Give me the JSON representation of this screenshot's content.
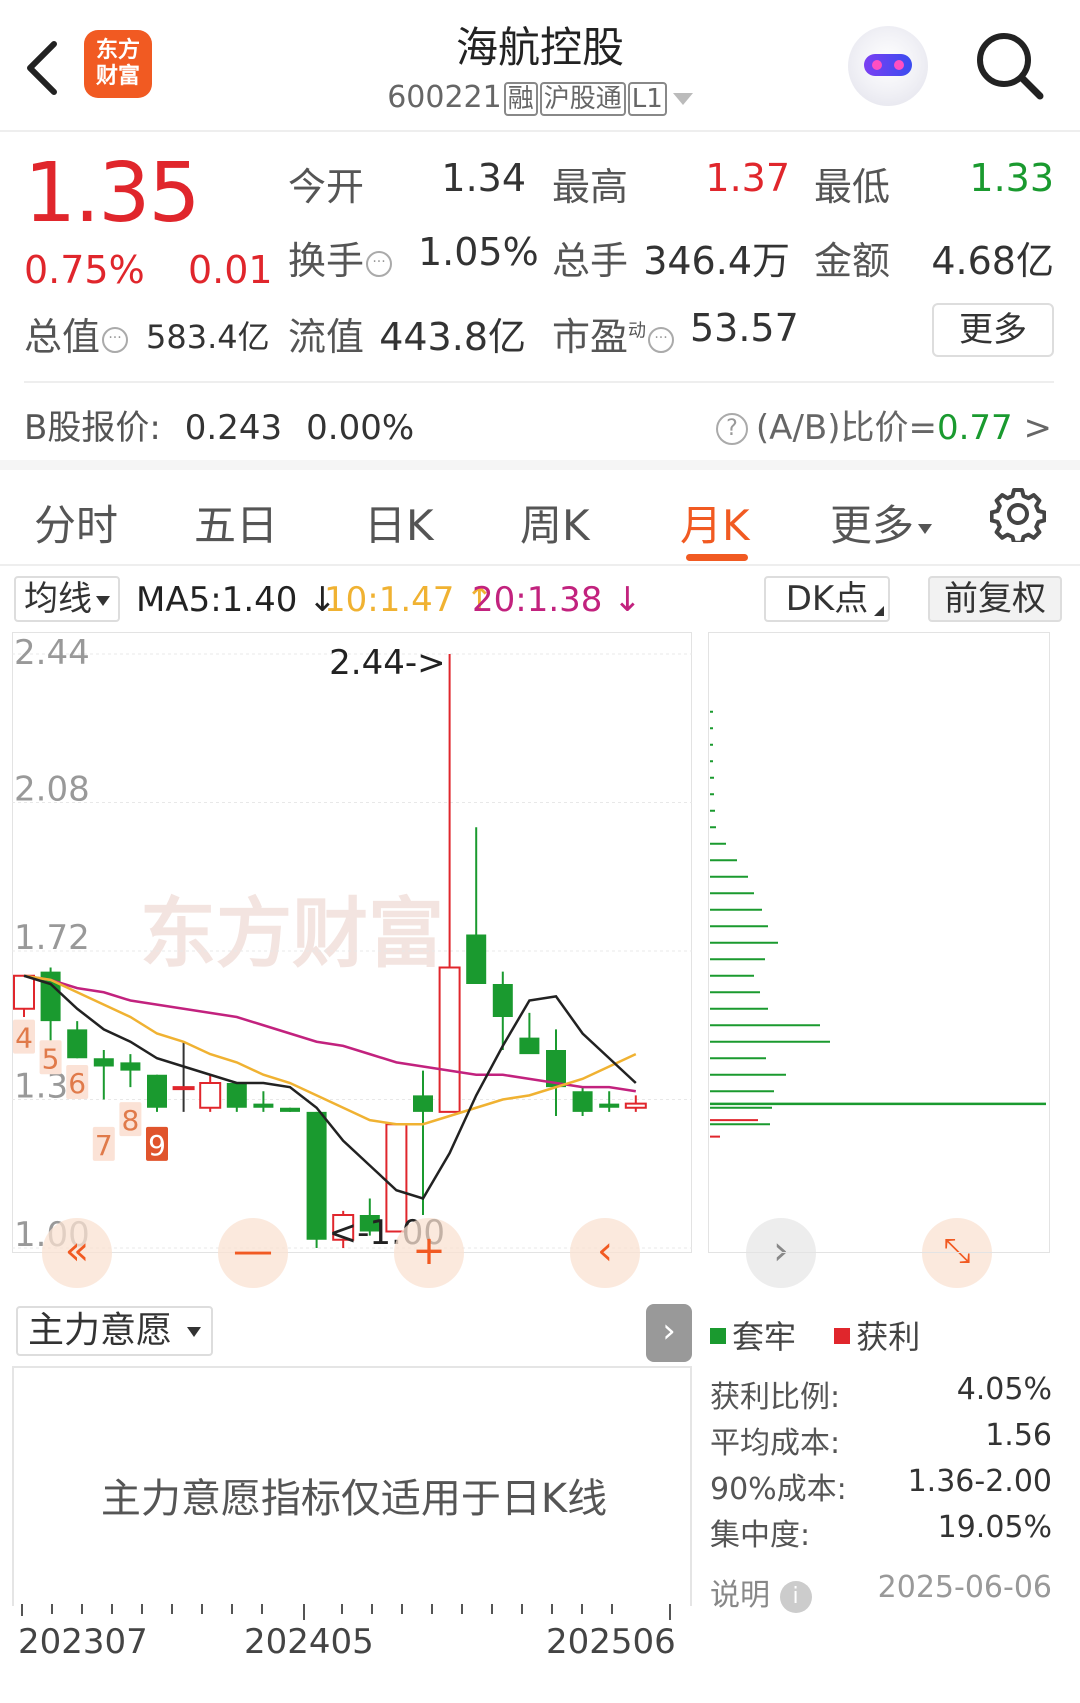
{
  "header": {
    "app_logo_line1": "东方",
    "app_logo_line2": "财富",
    "stock_name": "海航控股",
    "stock_code": "600221",
    "tags": [
      "融",
      "沪股通",
      "L1"
    ]
  },
  "quote": {
    "price": "1.35",
    "change_pct": "0.75%",
    "change": "0.01",
    "open_label": "今开",
    "open": "1.34",
    "high_label": "最高",
    "high": "1.37",
    "low_label": "最低",
    "low": "1.33",
    "turnover_label": "换手",
    "turnover": "1.05%",
    "volume_label": "总手",
    "volume": "346.4万",
    "amount_label": "金额",
    "amount": "4.68亿",
    "mktcap_label": "总值",
    "mktcap": "583.4亿",
    "float_label": "流值",
    "float": "443.8亿",
    "pe_label": "市盈",
    "pe_sup": "动",
    "pe": "53.57",
    "more_label": "更多"
  },
  "bshare": {
    "label": "B股报价:",
    "price": "0.243",
    "pct": "0.00%",
    "ratio_label": "(A/B)比价=",
    "ratio_value": "0.77",
    "ratio_arrow": ">"
  },
  "tabs": [
    "分时",
    "五日",
    "日K",
    "周K",
    "月K",
    "更多"
  ],
  "active_tab": "月K",
  "indicators": {
    "select_label": "均线",
    "ma5": "MA5:1.40",
    "ma5_arrow": "↓",
    "ma10": "10:1.47",
    "ma10_arrow": "↑",
    "ma20": "20:1.38",
    "ma20_arrow": "↓",
    "dk_label": "DK点",
    "adjust_label": "前复权"
  },
  "chart_data": {
    "type": "candlestick",
    "y_ticks": [
      "2.44",
      "2.08",
      "1.72",
      "1.36",
      "1.00"
    ],
    "ylim": [
      1.0,
      2.44
    ],
    "max_annotation": "2.44->",
    "min_annotation": "<-1.00",
    "x_labels": [
      "202307",
      "202405",
      "202506"
    ],
    "watermark": "东方财富",
    "candles": [
      {
        "o": 1.58,
        "h": 1.66,
        "l": 1.56,
        "c": 1.66
      },
      {
        "o": 1.67,
        "h": 1.68,
        "l": 1.5,
        "c": 1.55
      },
      {
        "o": 1.53,
        "h": 1.55,
        "l": 1.46,
        "c": 1.46
      },
      {
        "o": 1.46,
        "h": 1.48,
        "l": 1.36,
        "c": 1.44
      },
      {
        "o": 1.45,
        "h": 1.47,
        "l": 1.39,
        "c": 1.43
      },
      {
        "o": 1.42,
        "h": 1.42,
        "l": 1.33,
        "c": 1.34
      },
      {
        "o": 1.39,
        "h": 1.5,
        "l": 1.33,
        "c": 1.39
      },
      {
        "o": 1.34,
        "h": 1.42,
        "l": 1.33,
        "c": 1.4
      },
      {
        "o": 1.4,
        "h": 1.4,
        "l": 1.33,
        "c": 1.34
      },
      {
        "o": 1.35,
        "h": 1.38,
        "l": 1.33,
        "c": 1.34
      },
      {
        "o": 1.34,
        "h": 1.34,
        "l": 1.33,
        "c": 1.33
      },
      {
        "o": 1.33,
        "h": 1.33,
        "l": 1.0,
        "c": 1.02
      },
      {
        "o": 1.02,
        "h": 1.09,
        "l": 1.0,
        "c": 1.08
      },
      {
        "o": 1.08,
        "h": 1.12,
        "l": 1.03,
        "c": 1.04
      },
      {
        "o": 1.04,
        "h": 1.3,
        "l": 1.04,
        "c": 1.3
      },
      {
        "o": 1.37,
        "h": 1.43,
        "l": 1.08,
        "c": 1.33
      },
      {
        "o": 1.33,
        "h": 2.44,
        "l": 1.33,
        "c": 1.68
      },
      {
        "o": 1.76,
        "h": 2.02,
        "l": 1.64,
        "c": 1.64
      },
      {
        "o": 1.64,
        "h": 1.67,
        "l": 1.48,
        "c": 1.56
      },
      {
        "o": 1.51,
        "h": 1.57,
        "l": 1.48,
        "c": 1.47
      },
      {
        "o": 1.48,
        "h": 1.53,
        "l": 1.32,
        "c": 1.39
      },
      {
        "o": 1.38,
        "h": 1.39,
        "l": 1.32,
        "c": 1.33
      },
      {
        "o": 1.35,
        "h": 1.38,
        "l": 1.33,
        "c": 1.34
      },
      {
        "o": 1.34,
        "h": 1.37,
        "l": 1.33,
        "c": 1.35
      }
    ],
    "ma5": [
      1.66,
      1.64,
      1.58,
      1.53,
      1.5,
      1.46,
      1.44,
      1.42,
      1.4,
      1.4,
      1.39,
      1.34,
      1.26,
      1.2,
      1.14,
      1.12,
      1.23,
      1.37,
      1.49,
      1.6,
      1.61,
      1.52,
      1.46,
      1.4
    ],
    "ma10": [
      1.66,
      1.65,
      1.62,
      1.59,
      1.56,
      1.52,
      1.5,
      1.47,
      1.45,
      1.42,
      1.4,
      1.37,
      1.34,
      1.31,
      1.3,
      1.3,
      1.32,
      1.34,
      1.36,
      1.37,
      1.39,
      1.41,
      1.44,
      1.47
    ],
    "ma20": [
      1.66,
      1.65,
      1.63,
      1.62,
      1.6,
      1.59,
      1.58,
      1.57,
      1.56,
      1.54,
      1.52,
      1.5,
      1.49,
      1.47,
      1.45,
      1.44,
      1.43,
      1.42,
      1.42,
      1.41,
      1.4,
      1.39,
      1.39,
      1.38
    ],
    "sequence_markers": [
      {
        "label": "4",
        "candle": 0,
        "price": 1.51
      },
      {
        "label": "5",
        "candle": 1,
        "price": 1.46
      },
      {
        "label": "6",
        "candle": 2,
        "price": 1.4
      },
      {
        "label": "7",
        "candle": 3,
        "price": 1.25
      },
      {
        "label": "8",
        "candle": 4,
        "price": 1.31
      },
      {
        "label": "9",
        "candle": 5,
        "price": 1.25
      }
    ]
  },
  "chip_distribution": {
    "bars_green": [
      {
        "price": 2.3,
        "w": 3
      },
      {
        "price": 2.26,
        "w": 3
      },
      {
        "price": 2.22,
        "w": 3
      },
      {
        "price": 2.18,
        "w": 3
      },
      {
        "price": 2.14,
        "w": 4
      },
      {
        "price": 2.1,
        "w": 4
      },
      {
        "price": 2.06,
        "w": 5
      },
      {
        "price": 2.02,
        "w": 6
      },
      {
        "price": 1.98,
        "w": 16
      },
      {
        "price": 1.94,
        "w": 27
      },
      {
        "price": 1.9,
        "w": 38
      },
      {
        "price": 1.86,
        "w": 44
      },
      {
        "price": 1.82,
        "w": 52
      },
      {
        "price": 1.78,
        "w": 58
      },
      {
        "price": 1.74,
        "w": 68
      },
      {
        "price": 1.7,
        "w": 55
      },
      {
        "price": 1.66,
        "w": 44
      },
      {
        "price": 1.62,
        "w": 50
      },
      {
        "price": 1.58,
        "w": 58
      },
      {
        "price": 1.54,
        "w": 110
      },
      {
        "price": 1.5,
        "w": 120
      },
      {
        "price": 1.46,
        "w": 56
      },
      {
        "price": 1.42,
        "w": 76
      },
      {
        "price": 1.38,
        "w": 64
      },
      {
        "price": 1.34,
        "w": 62
      },
      {
        "price": 1.3,
        "w": 60
      }
    ],
    "current_line_price": 1.35,
    "bars_red": [
      {
        "price": 1.31,
        "w": 48
      },
      {
        "price": 1.27,
        "w": 10
      }
    ]
  },
  "lower": {
    "select_label": "主力意愿",
    "message": "主力意愿指标仅适用于日K线"
  },
  "legend": {
    "trapped": "套牢",
    "profit": "获利"
  },
  "stats": [
    {
      "label": "获利比例:",
      "value": "4.05%"
    },
    {
      "label": "平均成本:",
      "value": "1.56"
    },
    {
      "label": "90%成本:",
      "value": "1.36-2.00"
    },
    {
      "label": "集中度:",
      "value": "19.05%"
    }
  ],
  "footer": {
    "explain_label": "说明",
    "date": "2025-06-06"
  },
  "colors": {
    "up": "#e0262c",
    "down": "#1a9a2f",
    "accent": "#f15a22",
    "ma5": "#222222",
    "ma10": "#f0b232",
    "ma20": "#c2227e"
  }
}
